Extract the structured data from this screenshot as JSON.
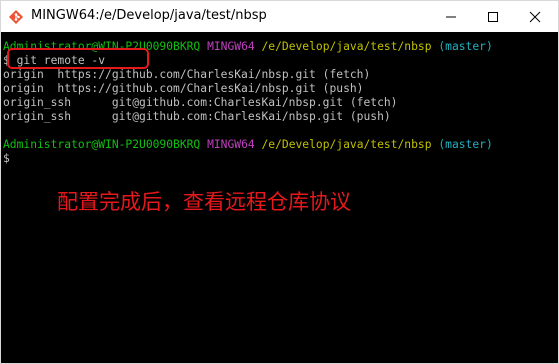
{
  "window": {
    "title": "MINGW64:/e/Develop/java/test/nbsp",
    "icon": "git-bash-icon",
    "buttons": [
      "minimize-icon",
      "maximize-icon",
      "close-icon"
    ]
  },
  "terminal": {
    "prompt1": {
      "user_host": "Administrator@WIN-P2U0090BKRQ",
      "env": "MINGW64",
      "path": "/e/Develop/java/test/nbsp",
      "branch": "(master)"
    },
    "command1": "$ git remote -v",
    "output": [
      "origin  https://github.com/CharlesKai/nbsp.git (fetch)",
      "origin  https://github.com/CharlesKai/nbsp.git (push)",
      "origin_ssh      git@github.com:CharlesKai/nbsp.git (fetch)",
      "origin_ssh      git@github.com:CharlesKai/nbsp.git (push)"
    ],
    "prompt2": {
      "user_host": "Administrator@WIN-P2U0090BKRQ",
      "env": "MINGW64",
      "path": "/e/Develop/java/test/nbsp",
      "branch": "(master)"
    },
    "command2": "$"
  },
  "annotation": {
    "text": "配置完成后，查看远程仓库协议",
    "color": "#e5181c"
  },
  "colors": {
    "background": "#000000",
    "user_host": "#10c010",
    "env": "#c040c0",
    "path": "#c0c000",
    "branch": "#20b0c0",
    "text": "#c0c0c0",
    "highlight": "#e5181c"
  }
}
